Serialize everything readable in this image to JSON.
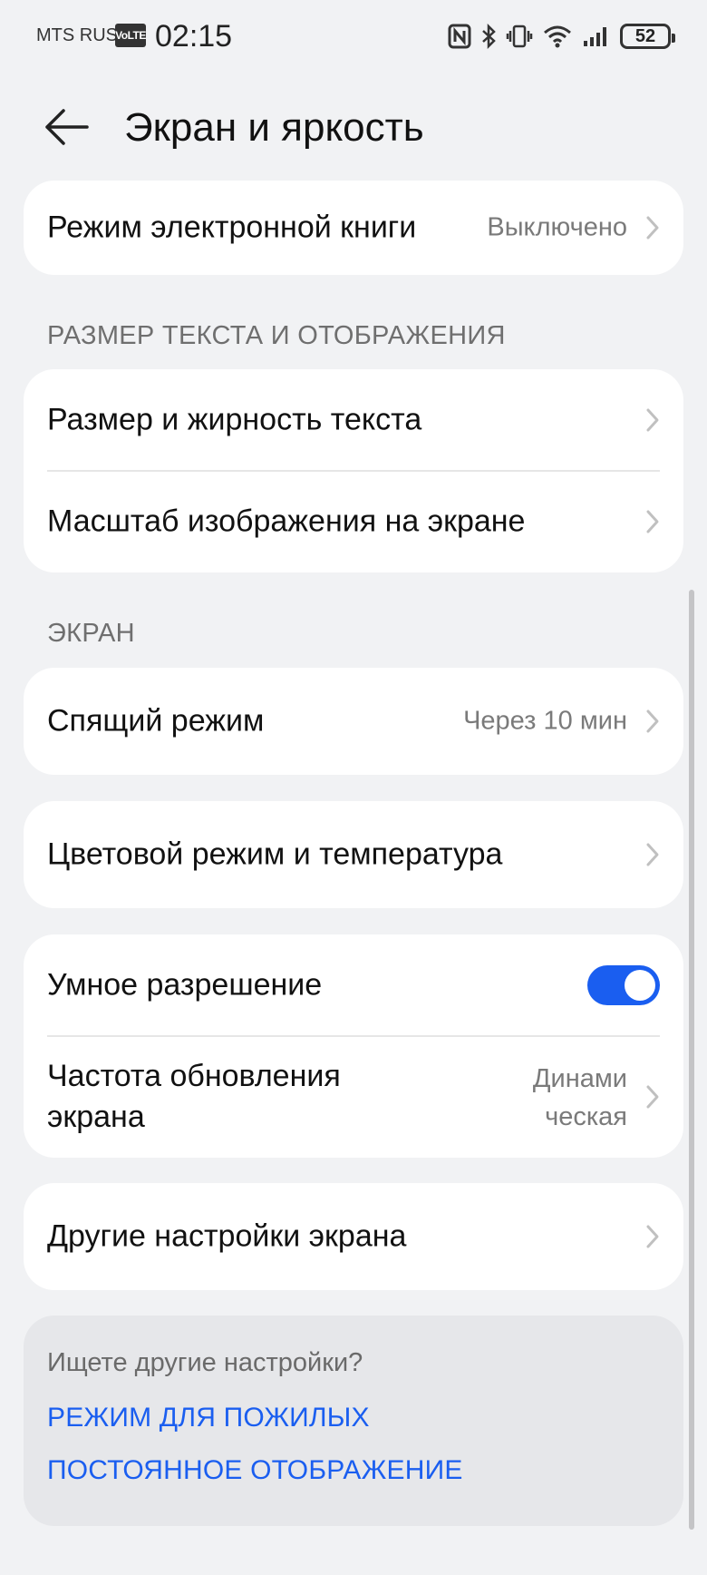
{
  "status_bar": {
    "carrier": "MTS RUS",
    "volte": "VoLTE",
    "time": "02:15",
    "battery": "52"
  },
  "header": {
    "title": "Экран и яркость"
  },
  "ebook": {
    "label": "Режим электронной книги",
    "value": "Выключено"
  },
  "section_text_display": {
    "header": "РАЗМЕР ТЕКСТА И ОТОБРАЖЕНИЯ",
    "items": [
      {
        "label": "Размер и жирность текста"
      },
      {
        "label": "Масштаб изображения на экране"
      }
    ]
  },
  "section_screen": {
    "header": "ЭКРАН",
    "sleep": {
      "label": "Спящий режим",
      "value": "Через 10 мин"
    },
    "color": {
      "label": "Цветовой режим и температура"
    },
    "smart_resolution": {
      "label": "Умное разрешение",
      "enabled": true
    },
    "refresh_rate": {
      "label_line1": "Частота обновления",
      "label_line2": "экрана",
      "value_line1": "Динами",
      "value_line2": "ческая"
    },
    "other": {
      "label": "Другие настройки экрана"
    }
  },
  "suggestions": {
    "title": "Ищете другие настройки?",
    "links": [
      "РЕЖИМ ДЛЯ ПОЖИЛЫХ",
      "ПОСТОЯННОЕ ОТОБРАЖЕНИЕ"
    ]
  },
  "colors": {
    "background": "#f1f2f4",
    "card": "#ffffff",
    "accent": "#1a5ef0",
    "secondary_text": "#7a7a7a"
  },
  "icons": {
    "back": "arrow-left-icon",
    "chevron": "chevron-right-icon",
    "nfc": "nfc-icon",
    "bluetooth": "bluetooth-icon",
    "vibrate": "vibrate-icon",
    "wifi": "wifi-icon",
    "signal": "signal-icon"
  }
}
